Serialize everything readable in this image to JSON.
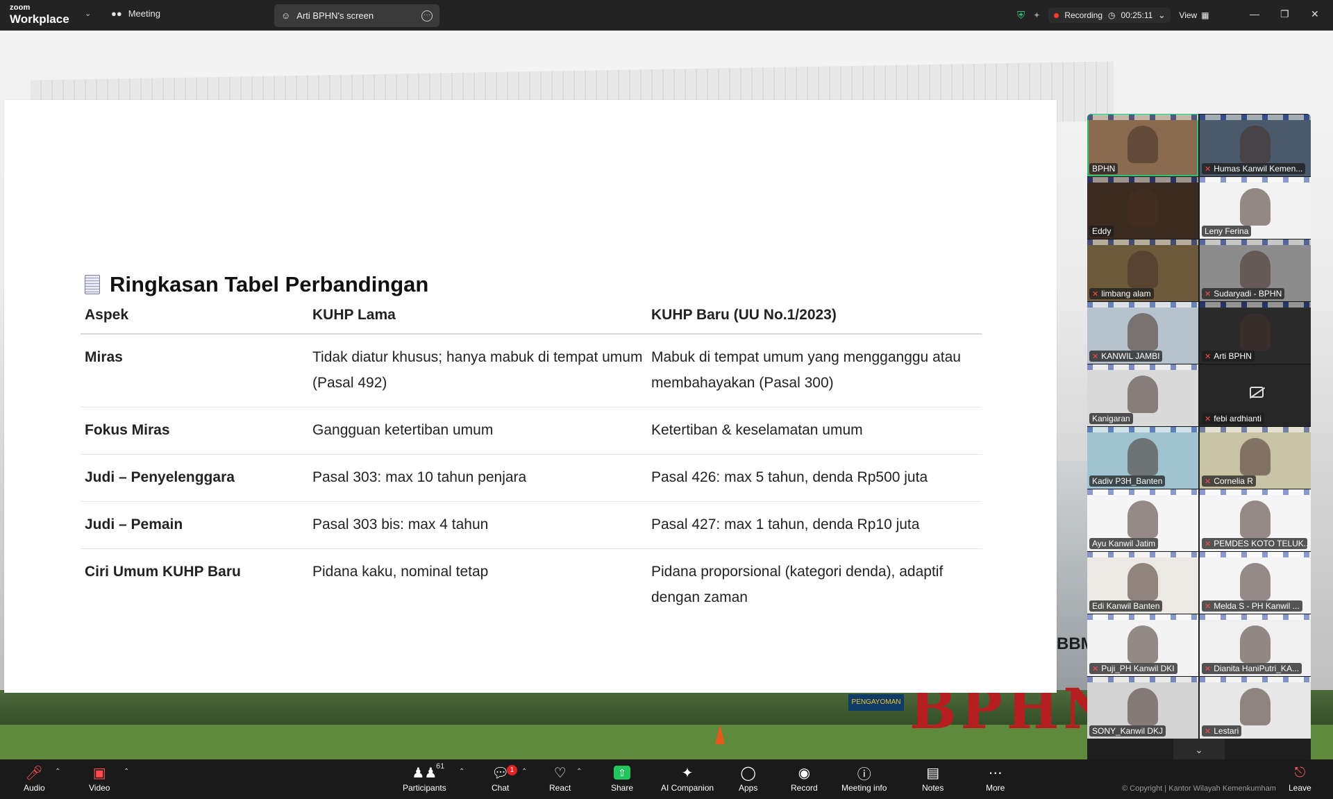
{
  "topbar": {
    "logo_line1": "zoom",
    "logo_line2": "Workplace",
    "meeting_label": "Meeting",
    "share_tab_label": "Arti BPHN's screen",
    "recording_label": "Recording",
    "timer": "00:25:11",
    "view_label": "View"
  },
  "slide": {
    "title": "Ringkasan Tabel Perbandingan",
    "headers": [
      "Aspek",
      "KUHP Lama",
      "KUHP Baru (UU No.1/2023)"
    ],
    "rows": [
      {
        "aspek": "Miras",
        "lama": "Tidak diatur khusus; hanya mabuk di tempat umum (Pasal 492)",
        "baru": "Mabuk di tempat umum yang mengganggu atau membahayakan (Pasal 300)"
      },
      {
        "aspek": "Fokus Miras",
        "lama": "Gangguan ketertiban umum",
        "baru": "Ketertiban & keselamatan umum"
      },
      {
        "aspek": "Judi – Penyelenggara",
        "lama": "Pasal 303: max 10 tahun penjara",
        "baru": "Pasal 426: max 5 tahun, denda Rp500 juta"
      },
      {
        "aspek": "Judi – Pemain",
        "lama": "Pasal 303 bis: max 4 tahun",
        "baru": "Pasal 427: max 1 tahun, denda Rp10 juta"
      },
      {
        "aspek": "Ciri Umum KUHP Baru",
        "lama": "Pidana kaku, nominal tetap",
        "baru": "Pidana proporsional (kategori denda), adaptif dengan zaman"
      }
    ]
  },
  "background": {
    "building_text": "BPHN",
    "bbm_text": "BBM",
    "sign_text": "PENGAYOMAN"
  },
  "participants": [
    {
      "name": "BPHN",
      "muted": false,
      "color": "#8a6b4f"
    },
    {
      "name": "Humas Kanwil Kemen...",
      "muted": true,
      "color": "#4a5a6a"
    },
    {
      "name": "Eddy",
      "muted": false,
      "color": "#3b2a20"
    },
    {
      "name": "Leny Ferina",
      "muted": false,
      "color": "#f2f2f2"
    },
    {
      "name": "limbang alam",
      "muted": true,
      "color": "#6d5a3a"
    },
    {
      "name": "Sudaryadi - BPHN",
      "muted": true,
      "color": "#8c8c8c"
    },
    {
      "name": "KANWIL JAMBI",
      "muted": true,
      "color": "#b7c3cc"
    },
    {
      "name": "Arti BPHN",
      "muted": true,
      "color": "#2a2a2a"
    },
    {
      "name": "Kanigaran",
      "muted": false,
      "color": "#d9d9d9"
    },
    {
      "name": "febi ardhianti",
      "muted": true,
      "color": "#262626",
      "camera_off": true
    },
    {
      "name": "Kadiv P3H_Banten",
      "muted": false,
      "color": "#9fc4cf"
    },
    {
      "name": "Cornelia R",
      "muted": true,
      "color": "#c9c3a6"
    },
    {
      "name": "Ayu Kanwil Jatim",
      "muted": false,
      "color": "#f5f5f5"
    },
    {
      "name": "PEMDES KOTO TELUK...",
      "muted": true,
      "color": "#f5f5f5"
    },
    {
      "name": "Edi Kanwil Banten",
      "muted": false,
      "color": "#ece9e4"
    },
    {
      "name": "Melda S - PH Kanwil ...",
      "muted": true,
      "color": "#f5f5f5"
    },
    {
      "name": "Puji_PH Kanwil DKI",
      "muted": true,
      "color": "#f3f3f3"
    },
    {
      "name": "Dianita HaniPutri_KA...",
      "muted": true,
      "color": "#f0f0f0"
    },
    {
      "name": "SONY_Kanwil DKJ",
      "muted": false,
      "color": "#d3d3d3"
    },
    {
      "name": "Lestari",
      "muted": true,
      "color": "#e8e8e8"
    }
  ],
  "toolbar": {
    "audio": "Audio",
    "video": "Video",
    "participants": "Participants",
    "participants_count": "61",
    "chat": "Chat",
    "chat_badge": "1",
    "react": "React",
    "share": "Share",
    "ai_companion": "AI Companion",
    "apps": "Apps",
    "record": "Record",
    "meeting_info": "Meeting info",
    "notes": "Notes",
    "more": "More",
    "leave": "Leave",
    "copyright": "© Copyright | Kantor Wilayah Kemenkumham"
  }
}
